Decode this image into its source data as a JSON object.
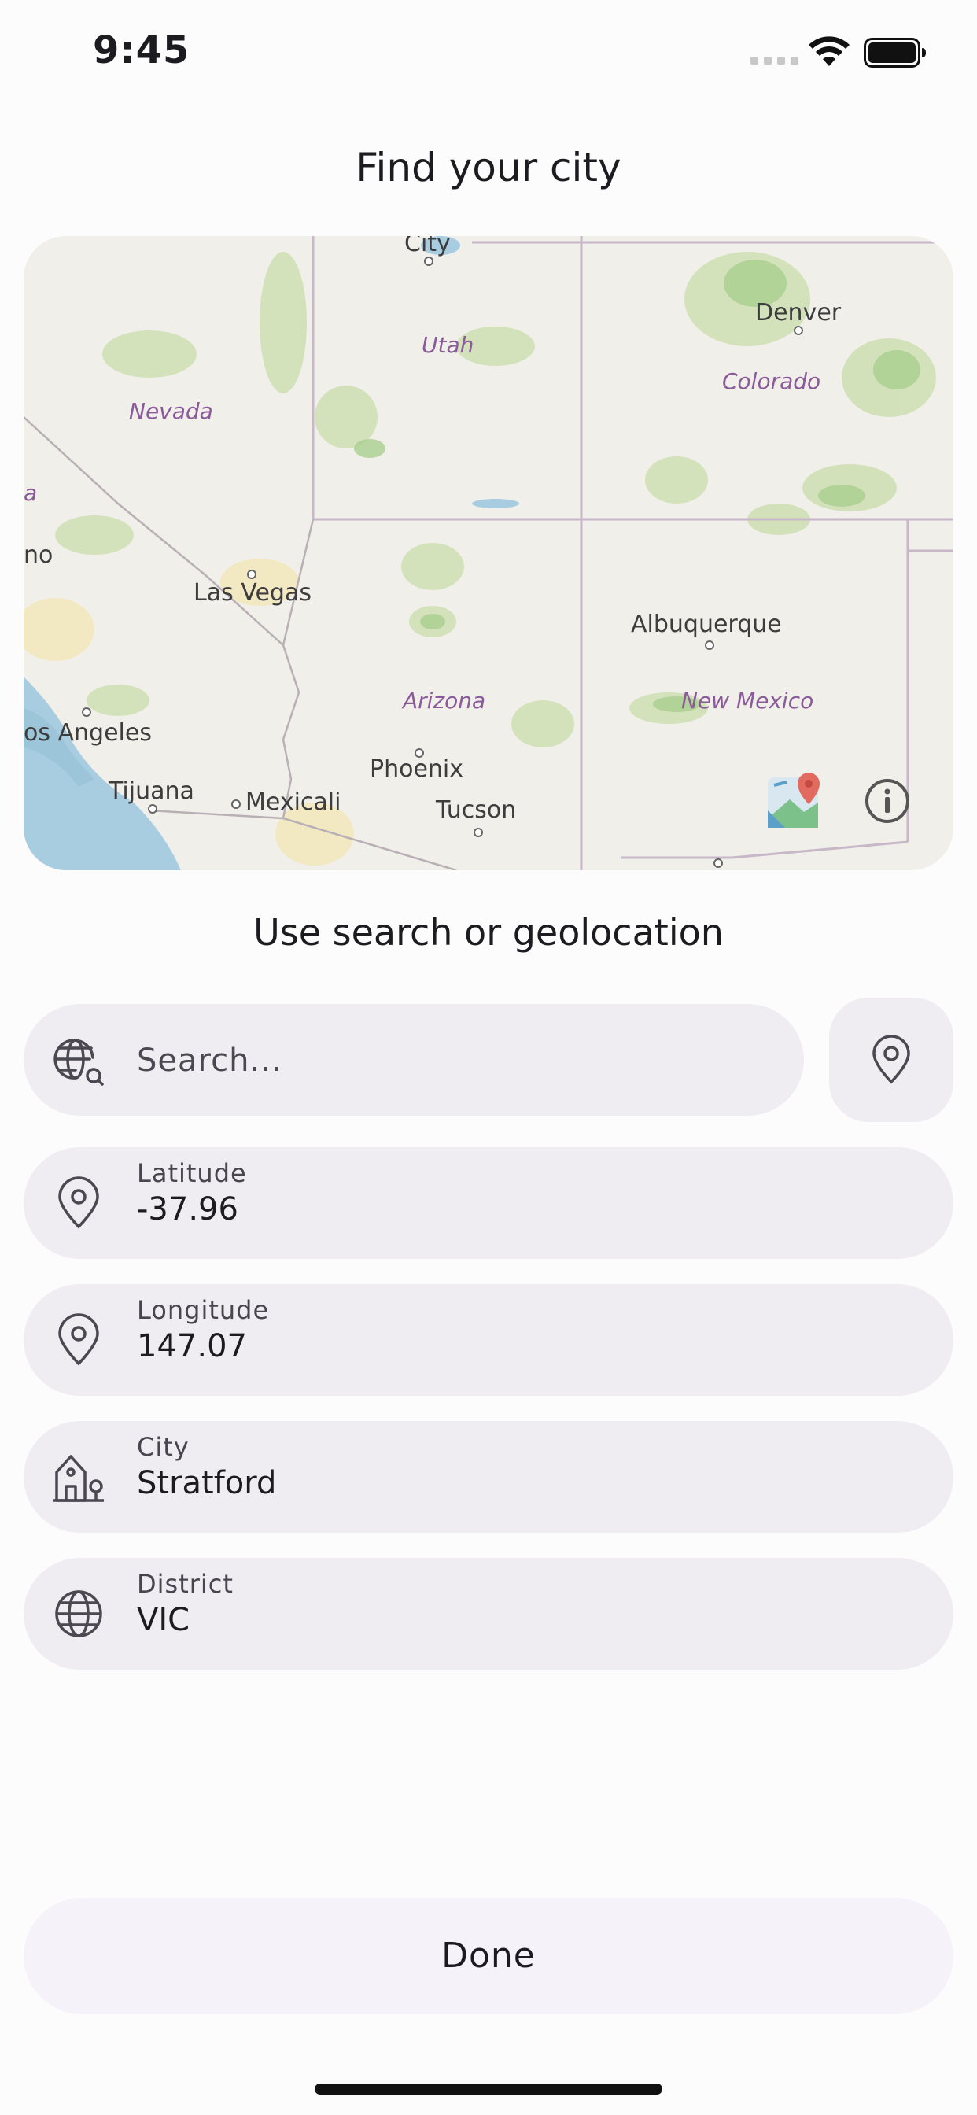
{
  "status_bar": {
    "time": "9:45"
  },
  "header": {
    "title": "Find your city"
  },
  "map": {
    "labels": {
      "city_top": "City",
      "utah": "Utah",
      "denver": "Denver",
      "colorado": "Colorado",
      "nevada": "Nevada",
      "edge_a": "a",
      "edge_no": "no",
      "las_vegas": "Las Vegas",
      "albuquerque": "Albuquerque",
      "arizona": "Arizona",
      "new_mexico": "New Mexico",
      "los_angeles": "os Angeles",
      "phoenix": "Phoenix",
      "tijuana": "Tijuana",
      "mexicali": "Mexicali",
      "tucson": "Tucson"
    },
    "icons": {
      "maps_app": "maps-app-icon",
      "info": "info-icon"
    }
  },
  "subtitle": "Use search or geolocation",
  "search": {
    "placeholder": "Search...",
    "value": "",
    "icon": "globe-search-icon"
  },
  "geolocation": {
    "icon": "location-pin-icon"
  },
  "fields": {
    "latitude": {
      "label": "Latitude",
      "value": "-37.96",
      "icon": "location-pin-icon"
    },
    "longitude": {
      "label": "Longitude",
      "value": "147.07",
      "icon": "location-pin-icon"
    },
    "city": {
      "label": "City",
      "value": "Stratford",
      "icon": "house-icon"
    },
    "district": {
      "label": "District",
      "value": "VIC",
      "icon": "globe-icon"
    }
  },
  "footer": {
    "done_label": "Done"
  },
  "colors": {
    "field_bg": "#efedf1",
    "done_bg": "#f6f2fa",
    "page_bg": "#fdfcfd"
  }
}
